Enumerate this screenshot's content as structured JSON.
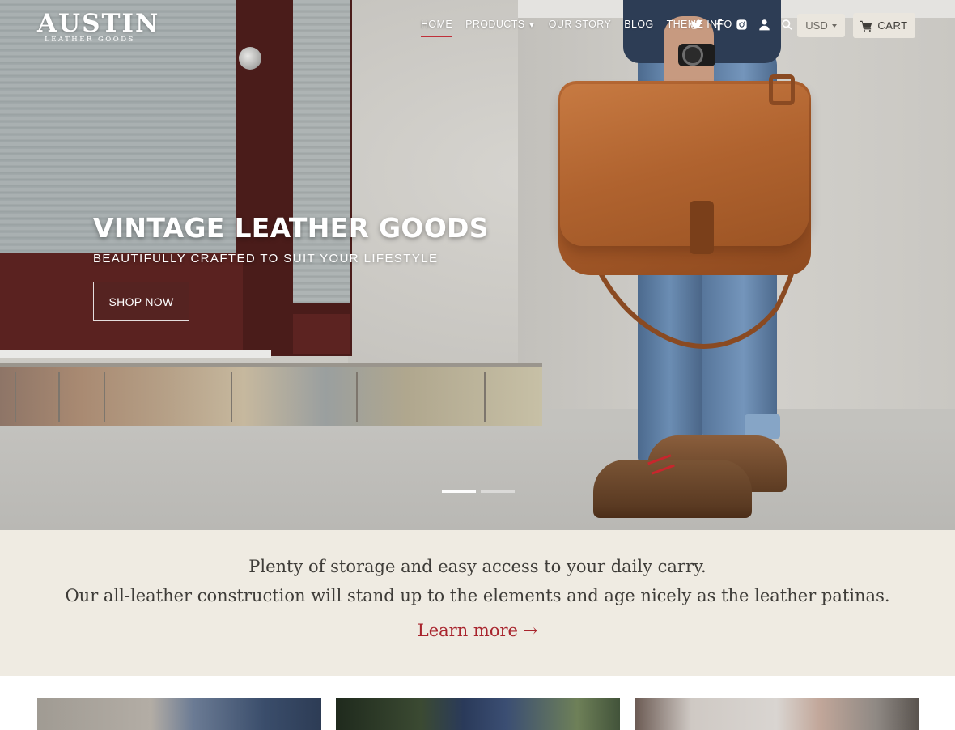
{
  "brand": {
    "name": "AUSTIN",
    "tagline": "LEATHER GOODS"
  },
  "nav": {
    "items": [
      {
        "label": "HOME",
        "active": true
      },
      {
        "label": "PRODUCTS",
        "has_dropdown": true
      },
      {
        "label": "OUR STORY"
      },
      {
        "label": "BLOG"
      },
      {
        "label": "THEME INFO"
      }
    ],
    "icons": [
      "twitter-icon",
      "facebook-icon",
      "instagram-icon",
      "account-icon",
      "search-icon"
    ],
    "currency": "USD",
    "cart_label": "CART"
  },
  "hero": {
    "title": "VINTAGE LEATHER GOODS",
    "subtitle": "BEAUTIFULLY CRAFTED TO SUIT YOUR LIFESTYLE",
    "cta_label": "SHOP NOW",
    "slides": 2,
    "active_slide": 1
  },
  "band": {
    "line1": "Plenty of storage and easy access to your daily carry.",
    "line2": "Our all-leather construction will stand up to the elements and age nicely as the leather patinas.",
    "link_label": "Learn more →"
  },
  "products": [
    {
      "name": "product-tile-1"
    },
    {
      "name": "product-tile-2"
    },
    {
      "name": "product-tile-3"
    }
  ],
  "colors": {
    "accent": "#c0303a",
    "link": "#a8242d",
    "band_bg": "#efebe2",
    "button_bg": "#eae6de"
  }
}
